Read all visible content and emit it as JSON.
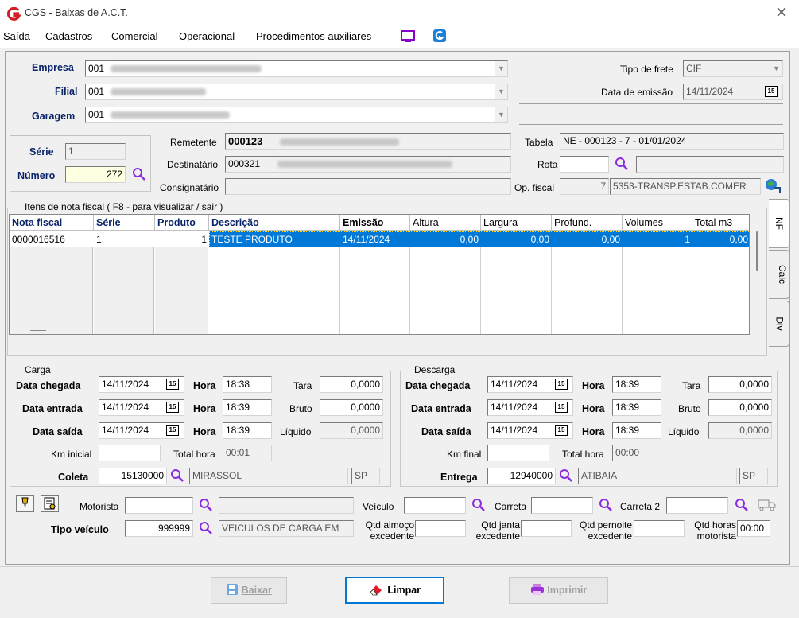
{
  "window": {
    "title": "CGS - Baixas de A.C.T.",
    "close_glyph": "✕"
  },
  "menu": [
    "Saída",
    "Cadastros",
    "Comercial",
    "Operacional",
    "Procedimentos auxiliares"
  ],
  "header": {
    "empresa_label": "Empresa",
    "empresa_value": "001",
    "filial_label": "Filial",
    "filial_value": "001",
    "garagem_label": "Garagem",
    "garagem_value": "001",
    "tipo_frete_label": "Tipo de frete",
    "tipo_frete_value": "CIF",
    "data_emissao_label": "Data de emissão",
    "data_emissao_value": "14/11/2024",
    "serie_label": "Série",
    "serie_value": "1",
    "numero_label": "Número",
    "numero_value": "272",
    "remetente_label": "Remetente",
    "remetente_value": "000123",
    "destinatario_label": "Destinatário",
    "destinatario_value": "000321",
    "consignatario_label": "Consignatário",
    "tabela_label": "Tabela",
    "tabela_value": "NE - 000123 - 7 - 01/01/2024",
    "rota_label": "Rota",
    "op_fiscal_label": "Op. fiscal",
    "op_fiscal_code": "7",
    "op_fiscal_desc": "5353-TRANSP.ESTAB.COMER"
  },
  "items": {
    "group_title": "Itens de nota fiscal ( F8 - para visualizar / sair )",
    "columns": [
      "Nota fiscal",
      "Série",
      "Produto",
      "Descrição",
      "Emissão",
      "Altura",
      "Largura",
      "Profund.",
      "Volumes",
      "Total m3"
    ],
    "row": [
      "0000016516",
      "1",
      "1",
      "TESTE PRODUTO",
      "14/11/2024",
      "0,00",
      "0,00",
      "0,00",
      "1",
      "0,00"
    ],
    "tabs": [
      "NF",
      "Calc",
      "Div"
    ]
  },
  "carga": {
    "title": "Carga",
    "data_chegada_label": "Data chegada",
    "data_chegada": "14/11/2024",
    "data_entrada_label": "Data entrada",
    "data_entrada": "14/11/2024",
    "data_saida_label": "Data saída",
    "data_saida": "14/11/2024",
    "hora_label": "Hora",
    "hora1": "18:38",
    "hora2": "18:39",
    "hora3": "18:39",
    "tara_label": "Tara",
    "tara": "0,0000",
    "bruto_label": "Bruto",
    "bruto": "0,0000",
    "liquido_label": "Líquido",
    "liquido": "0,0000",
    "km_label": "Km inicial",
    "total_hora_label": "Total hora",
    "total_hora": "00:01",
    "coleta_label": "Coleta",
    "coleta_code": "15130000",
    "coleta_city": "MIRASSOL",
    "coleta_uf": "SP"
  },
  "descarga": {
    "title": "Descarga",
    "data_chegada_label": "Data chegada",
    "data_chegada": "14/11/2024",
    "data_entrada_label": "Data entrada",
    "data_entrada": "14/11/2024",
    "data_saida_label": "Data saída",
    "data_saida": "14/11/2024",
    "hora_label": "Hora",
    "hora1": "18:39",
    "hora2": "18:39",
    "hora3": "18:39",
    "tara_label": "Tara",
    "tara": "0,0000",
    "bruto_label": "Bruto",
    "bruto": "0,0000",
    "liquido_label": "Líquido",
    "liquido": "0,0000",
    "km_label": "Km final",
    "total_hora_label": "Total hora",
    "total_hora": "00:00",
    "entrega_label": "Entrega",
    "entrega_code": "12940000",
    "entrega_city": "ATIBAIA",
    "entrega_uf": "SP"
  },
  "vehicle": {
    "motorista_label": "Motorista",
    "veiculo_label": "Veículo",
    "carreta_label": "Carreta",
    "carreta2_label": "Carreta 2",
    "tipo_veiculo_label": "Tipo veículo",
    "tipo_veiculo_code": "999999",
    "tipo_veiculo_desc": "VEICULOS DE CARGA EM",
    "qtd_almoco_label1": "Qtd almoço",
    "qtd_almoco_label2": "excedente",
    "qtd_janta_label1": "Qtd janta",
    "qtd_janta_label2": "excedente",
    "qtd_pernoite_label1": "Qtd pernoite",
    "qtd_pernoite_label2": "excedente",
    "qtd_horas_label1": "Qtd horas",
    "qtd_horas_label2": "motorista",
    "qtd_horas_value": "00:00"
  },
  "buttons": {
    "baixar": "Baixar",
    "limpar": "Limpar",
    "imprimir": "Imprimir"
  },
  "colors": {
    "accent": "#0078d7",
    "selection": "#0078d7",
    "logo_red": "#d21f26"
  }
}
